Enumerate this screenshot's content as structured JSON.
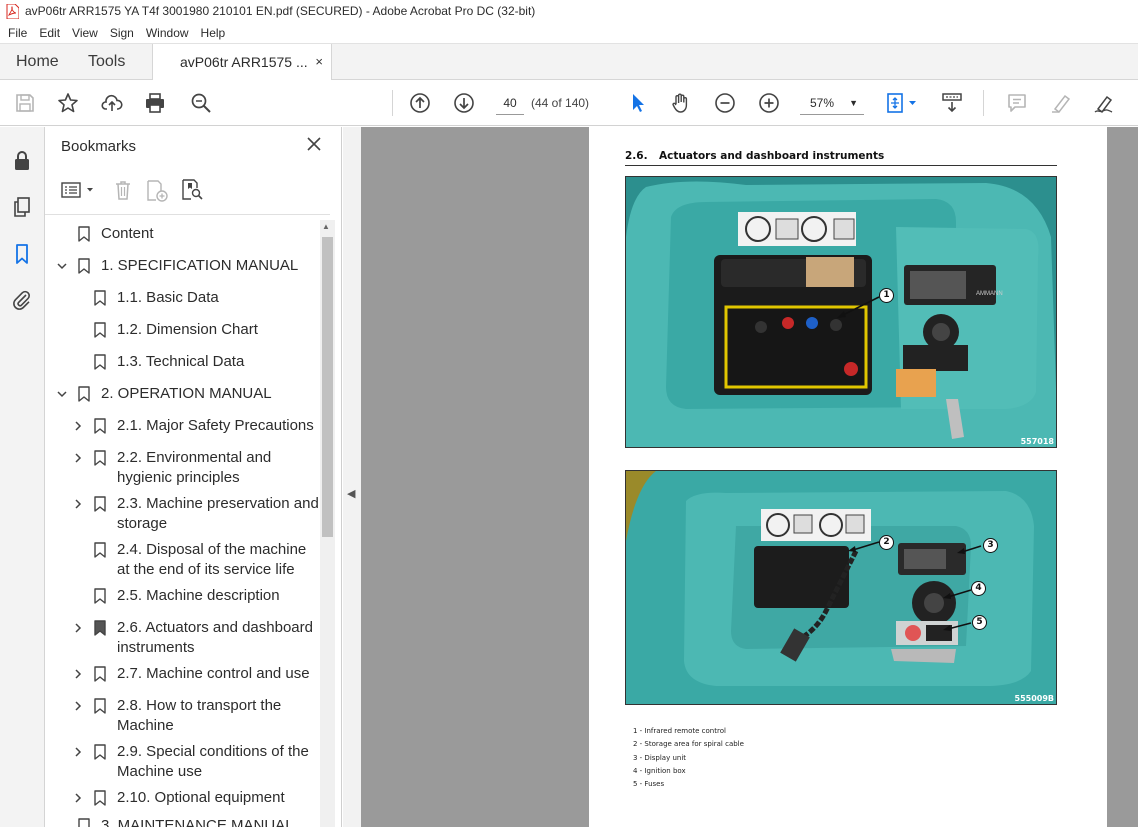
{
  "window": {
    "title": "avP06tr ARR1575 YA T4f 3001980 210101 EN.pdf (SECURED) - Adobe Acrobat Pro DC (32-bit)"
  },
  "menu": [
    "File",
    "Edit",
    "View",
    "Sign",
    "Window",
    "Help"
  ],
  "tabs": {
    "home": "Home",
    "tools": "Tools",
    "document": "avP06tr ARR1575 ...",
    "close": "×"
  },
  "toolbar": {
    "page_number": "40",
    "page_count": "(44 of 140)",
    "zoom": "57%"
  },
  "bookmarks": {
    "title": "Bookmarks",
    "items": [
      {
        "label": "Content"
      },
      {
        "label": "1. SPECIFICATION MANUAL"
      },
      {
        "label": "1.1. Basic Data"
      },
      {
        "label": "1.2. Dimension Chart"
      },
      {
        "label": "1.3. Technical Data"
      },
      {
        "label": "2. OPERATION MANUAL"
      },
      {
        "label": "2.1. Major Safety Precautions"
      },
      {
        "label": "2.2. Environmental and",
        "label2": "hygienic principles"
      },
      {
        "label": "2.3. Machine preservation and",
        "label2": "storage"
      },
      {
        "label": "2.4. Disposal of the machine",
        "label2": "at the end of its service life"
      },
      {
        "label": "2.5. Machine description"
      },
      {
        "label": "2.6. Actuators and dashboard",
        "label2": "instruments"
      },
      {
        "label": "2.7. Machine control and use"
      },
      {
        "label": "2.8. How to transport the",
        "label2": "Machine"
      },
      {
        "label": "2.9. Special conditions of the",
        "label2": "Machine use"
      },
      {
        "label": "2.10. Optional equipment"
      },
      {
        "label": "3. MAINTENANCE MANUAL"
      }
    ]
  },
  "document": {
    "section_number": "2.6.",
    "section_title": "Actuators and dashboard instruments",
    "photo1_code": "557018",
    "photo2_code": "555009B",
    "callouts": [
      "1",
      "2",
      "3",
      "4",
      "5"
    ],
    "photo1_labels": [
      "AMMANN"
    ],
    "legend": [
      "1 - Infrared remote control",
      "2 - Storage area for spiral cable",
      "3 - Display unit",
      "4 - Ignition box",
      "5 - Fuses"
    ]
  },
  "colors": {
    "accent_blue": "#1473e6",
    "machine_teal": "#3aa9a5",
    "viewer_gray": "#9a9a9a"
  }
}
